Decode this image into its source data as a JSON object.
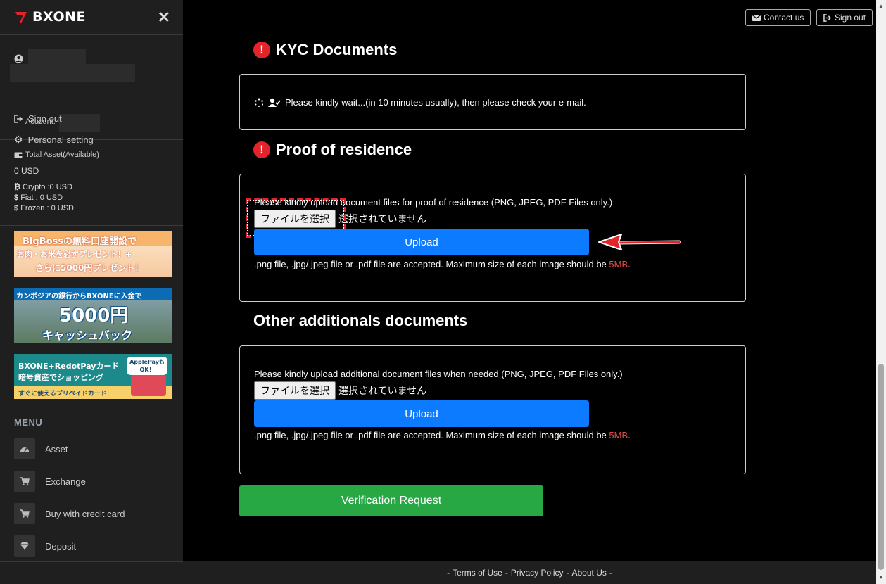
{
  "brand": {
    "name": "BXONE",
    "accent": "#e3242b"
  },
  "sidebar": {
    "account_label": "Account:",
    "personal_setting": "Personal setting",
    "sign_out": "Sign out",
    "asset": {
      "title": "Total Asset(Available)",
      "total": "0 USD",
      "crypto": "Crypto :0 USD",
      "fiat": "Fiat : 0 USD",
      "frozen": "Frozen : 0 USD"
    },
    "banners": [
      {
        "line1": "BigBossの無料口座開設で",
        "line2": "お肉・お米を必ずプレゼント！+",
        "line3": "さらに5000円プレゼント！"
      },
      {
        "line1": "カンボジアの銀行からBXONEに入金で",
        "line2": "5000円",
        "line3": "キャッシュバック"
      },
      {
        "line1": "BXONE+RedotPayカード",
        "line2": "暗号資産でショッピング",
        "line3": "すぐに使えるプリペイドカード",
        "badge": "ApplePayも OK！"
      }
    ],
    "menu_heading": "MENU",
    "menu": [
      {
        "label": "Asset",
        "icon": "gauge-icon"
      },
      {
        "label": "Exchange",
        "icon": "cart-icon"
      },
      {
        "label": "Buy with credit card",
        "icon": "cart-icon"
      },
      {
        "label": "Deposit",
        "icon": "diamond-icon"
      }
    ]
  },
  "header": {
    "contact": "Contact us",
    "sign_out": "Sign out"
  },
  "kyc": {
    "title": "KYC Documents",
    "message": "Please kindly wait...(in 10 minutes usually), then please check your e-mail."
  },
  "residence": {
    "title": "Proof of residence",
    "instruction": "Please kindly upload document files for proof of residence (PNG, JPEG, PDF Files only.)",
    "file_button": "ファイルを選択",
    "file_status": "選択されていません",
    "upload": "Upload",
    "hint": ".png file, .jpg/.jpeg file or .pdf file are accepted. Maximum size of each image should be ",
    "hint_size": "5MB",
    "hint_end": "."
  },
  "additional": {
    "title": "Other additionals documents",
    "instruction": "Please kindly upload additional document files when needed (PNG, JPEG, PDF Files only.)",
    "file_button": "ファイルを選択",
    "file_status": "選択されていません",
    "upload": "Upload",
    "hint": ".png file, .jpg/.jpeg file or .pdf file are accepted. Maximum size of each image should be ",
    "hint_size": "5MB",
    "hint_end": "."
  },
  "verify_button": "Verification Request",
  "footer": {
    "sep": "-",
    "terms": "Terms of Use",
    "privacy": "Privacy Policy",
    "about": "About Us"
  }
}
